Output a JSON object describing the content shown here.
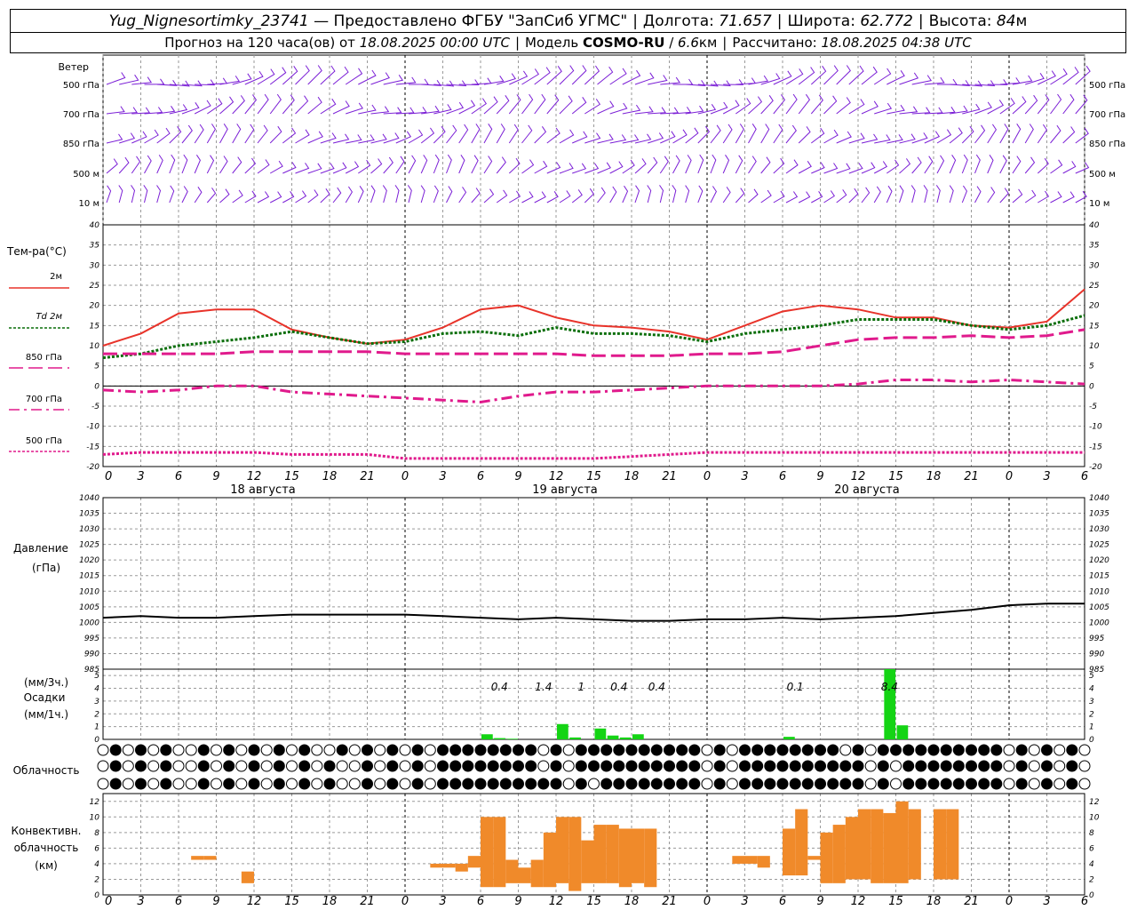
{
  "header": {
    "station": "Yug_Nignesortimky_23741",
    "provider": "— Предоставлено ФГБУ \"ЗапСиб УГМС\"",
    "lon_label": "Долгота:",
    "lon": "71.657",
    "lat_label": "Широта:",
    "lat": "62.772",
    "alt_label": "Высота:",
    "alt": "84",
    "alt_unit": "м",
    "forecast_label": "Прогноз на 120 часа(ов) от",
    "forecast_start": "18.08.2025 00:00 UTC",
    "model_label": "Модель",
    "model": "COSMO-RU",
    "resolution": "6.6",
    "resolution_unit": "км",
    "calc_label": "Рассчитано:",
    "calc_time": "18.08.2025 04:38 UTC"
  },
  "colors": {
    "wind": "#7b1fd6",
    "t2m": "#e8332a",
    "td2m": "#0a6e0a",
    "iso": "#e01a8c",
    "pressure": "#000000",
    "precip": "#14d414",
    "conv": "#f08a2a",
    "grid": "#9a9a9a"
  },
  "x_axis": {
    "ticks": [
      "0",
      "3",
      "6",
      "9",
      "12",
      "15",
      "18",
      "21",
      "0",
      "3",
      "6",
      "9",
      "12",
      "15",
      "18",
      "21",
      "0",
      "3",
      "6",
      "9",
      "12",
      "15",
      "18",
      "21",
      "0",
      "3",
      "6"
    ],
    "days": [
      "18 августа",
      "19 августа",
      "20 августа"
    ]
  },
  "panels": {
    "wind": {
      "title": "Ветер",
      "levels": [
        "500 гПа",
        "700 гПа",
        "850 гПа",
        "500 м",
        "10 м"
      ]
    },
    "temperature": {
      "title": "Тем-ра(°С)",
      "y_ticks": [
        "40",
        "35",
        "30",
        "25",
        "20",
        "15",
        "10",
        "5",
        "0",
        "-5",
        "-10",
        "-15",
        "-20"
      ]
    },
    "pressure": {
      "title": "Давление",
      "unit": "(гПа)",
      "y_ticks": [
        "1040",
        "1035",
        "1030",
        "1025",
        "1020",
        "1015",
        "1010",
        "1005",
        "1000",
        "995",
        "990",
        "985"
      ]
    },
    "precip": {
      "unit3": "(мм/3ч.)",
      "title": "Осадки",
      "unit1": "(мм/1ч.)",
      "y_ticks": [
        "5",
        "4",
        "3",
        "2",
        "1",
        "0"
      ]
    },
    "cloud": {
      "title": "Облачность"
    },
    "convective": {
      "title1": "Конвективн.",
      "title2": "облачность",
      "unit": "(км)",
      "y_ticks": [
        "12",
        "10",
        "8",
        "6",
        "4",
        "2",
        "0"
      ]
    }
  },
  "chart_data": [
    {
      "type": "line",
      "title": "Тем-ра(°С)",
      "x_unit": "hours since 18.08.2025 00:00 UTC",
      "ylim": [
        -20,
        40
      ],
      "series": [
        {
          "name": "2м",
          "x": [
            0,
            3,
            6,
            9,
            12,
            15,
            18,
            21,
            24,
            27,
            30,
            33,
            36,
            39,
            42,
            45,
            48,
            51,
            54,
            57,
            60,
            63,
            66,
            69,
            72,
            75,
            78
          ],
          "values": [
            10,
            13,
            18,
            19,
            19,
            14,
            12,
            10.5,
            11.5,
            14.5,
            19,
            20,
            17,
            15,
            14.5,
            13.5,
            11.5,
            15,
            18.5,
            20,
            19,
            17,
            17,
            15,
            14.5,
            16,
            24
          ]
        },
        {
          "name": "Td 2м",
          "x": [
            0,
            3,
            6,
            9,
            12,
            15,
            18,
            21,
            24,
            27,
            30,
            33,
            36,
            39,
            42,
            45,
            48,
            51,
            54,
            57,
            60,
            63,
            66,
            69,
            72,
            75,
            78
          ],
          "values": [
            7,
            8,
            10,
            11,
            12,
            13.5,
            12,
            10.5,
            11,
            13,
            13.5,
            12.5,
            14.5,
            13,
            13,
            12.5,
            11,
            13,
            14,
            15,
            16.5,
            16.5,
            16.5,
            15,
            14,
            15,
            17.5
          ]
        },
        {
          "name": "850 гПа",
          "x": [
            0,
            3,
            6,
            9,
            12,
            15,
            18,
            21,
            24,
            27,
            30,
            33,
            36,
            39,
            42,
            45,
            48,
            51,
            54,
            57,
            60,
            63,
            66,
            69,
            72,
            75,
            78
          ],
          "values": [
            8,
            8,
            8,
            8,
            8.5,
            8.5,
            8.5,
            8.5,
            8,
            8,
            8,
            8,
            8,
            7.5,
            7.5,
            7.5,
            8,
            8,
            8.5,
            10,
            11.5,
            12,
            12,
            12.5,
            12,
            12.5,
            14
          ]
        },
        {
          "name": "700 гПа",
          "x": [
            0,
            3,
            6,
            9,
            12,
            15,
            18,
            21,
            24,
            27,
            30,
            33,
            36,
            39,
            42,
            45,
            48,
            51,
            54,
            57,
            60,
            63,
            66,
            69,
            72,
            75,
            78
          ],
          "values": [
            -1,
            -1.5,
            -1,
            0,
            0,
            -1.5,
            -2,
            -2.5,
            -3,
            -3.5,
            -4,
            -2.5,
            -1.5,
            -1.5,
            -1,
            -0.5,
            0,
            0,
            0,
            0,
            0.5,
            1.5,
            1.5,
            1,
            1.5,
            1,
            0.5
          ]
        },
        {
          "name": "500 гПа",
          "x": [
            0,
            3,
            6,
            9,
            12,
            15,
            18,
            21,
            24,
            27,
            30,
            33,
            36,
            39,
            42,
            45,
            48,
            51,
            54,
            57,
            60,
            63,
            66,
            69,
            72,
            75,
            78
          ],
          "values": [
            -17,
            -16.5,
            -16.5,
            -16.5,
            -16.5,
            -17,
            -17,
            -17,
            -18,
            -18,
            -18,
            -18,
            -18,
            -18,
            -17.5,
            -17,
            -16.5,
            -16.5,
            -16.5,
            -16.5,
            -16.5,
            -16.5,
            -16.5,
            -16.5,
            -16.5,
            -16.5,
            -16.5
          ]
        }
      ]
    },
    {
      "type": "line",
      "title": "Давление",
      "ylabel": "(гПа)",
      "ylim": [
        985,
        1040
      ],
      "series": [
        {
          "x": [
            0,
            3,
            6,
            9,
            12,
            15,
            18,
            21,
            24,
            27,
            30,
            33,
            36,
            39,
            42,
            45,
            48,
            51,
            54,
            57,
            60,
            63,
            66,
            69,
            72,
            75,
            78
          ],
          "values": [
            1001.5,
            1002,
            1001.5,
            1001.5,
            1002,
            1002.5,
            1002.5,
            1002.5,
            1002.5,
            1002,
            1001.5,
            1001,
            1001.5,
            1001,
            1000.5,
            1000.5,
            1001,
            1001,
            1001.5,
            1001,
            1001.5,
            1002,
            1003,
            1004,
            1005.5,
            1006,
            1006
          ]
        }
      ]
    },
    {
      "type": "bar",
      "title": "Осадки",
      "ylabel": "(мм/1ч.)",
      "ylim": [
        0,
        5.5
      ],
      "x": [
        30,
        31,
        32,
        36,
        37,
        39,
        40,
        41,
        42,
        54,
        62,
        63
      ],
      "values": [
        0.4,
        0.1,
        0.05,
        1.2,
        0.15,
        0.85,
        0.3,
        0.15,
        0.4,
        0.2,
        5.5,
        1.1
      ],
      "labels": [
        {
          "x": 31.5,
          "text": "0.4"
        },
        {
          "x": 35,
          "text": "1.4"
        },
        {
          "x": 38,
          "text": "1"
        },
        {
          "x": 41,
          "text": "0.4"
        },
        {
          "x": 44,
          "text": "0.4"
        },
        {
          "x": 55,
          "text": "0.1"
        },
        {
          "x": 62.5,
          "text": "8.4"
        }
      ]
    },
    {
      "type": "bar",
      "title": "Конвективн. облачность",
      "ylabel": "(км)",
      "ylim": [
        0,
        13
      ],
      "x": [
        7,
        8,
        11,
        26,
        27,
        28,
        29,
        30,
        31,
        32,
        33,
        34,
        35,
        36,
        37,
        38,
        39,
        40,
        41,
        42,
        43,
        50,
        51,
        52,
        54,
        55,
        56,
        57,
        58,
        59,
        60,
        61,
        62,
        63,
        64,
        66,
        67
      ],
      "base": [
        4.5,
        4.5,
        1.5,
        3.5,
        3.5,
        3,
        3.5,
        1,
        1,
        1.5,
        1.5,
        1,
        1,
        1.5,
        0.5,
        1.5,
        1.5,
        1.5,
        1,
        1.5,
        1,
        4,
        4,
        3.5,
        2.5,
        2.5,
        4.5,
        1.5,
        1.5,
        2,
        2,
        1.5,
        1.5,
        1.5,
        2,
        2,
        2
      ],
      "top": [
        5,
        5,
        3,
        4,
        4,
        4,
        5,
        10,
        10,
        4.5,
        3.5,
        4.5,
        8,
        10,
        10,
        7,
        9,
        9,
        8.5,
        8.5,
        8.5,
        5,
        5,
        5,
        8.5,
        11,
        5,
        8,
        9,
        10,
        11,
        11,
        10.5,
        12,
        11,
        11,
        11
      ]
    }
  ]
}
